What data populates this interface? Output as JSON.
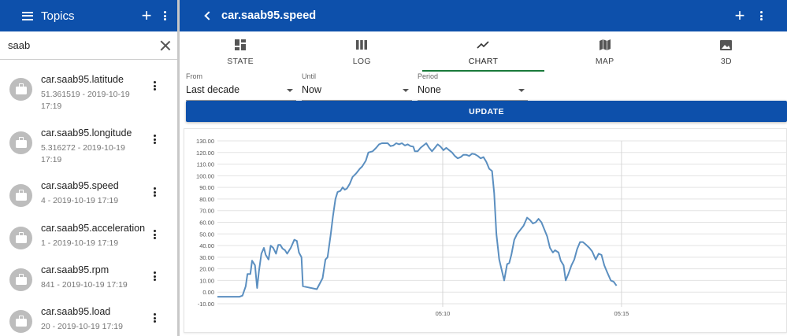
{
  "sidebar": {
    "title": "Topics",
    "search": {
      "value": "saab"
    },
    "topics": [
      {
        "name": "car.saab95.latitude",
        "detail": "51.361519 - 2019-10-19 17:19"
      },
      {
        "name": "car.saab95.longitude",
        "detail": "5.316272 - 2019-10-19 17:19"
      },
      {
        "name": "car.saab95.speed",
        "detail": "4 - 2019-10-19 17:19"
      },
      {
        "name": "car.saab95.acceleration",
        "detail": "1 - 2019-10-19 17:19"
      },
      {
        "name": "car.saab95.rpm",
        "detail": "841 - 2019-10-19 17:19"
      },
      {
        "name": "car.saab95.load",
        "detail": "20 - 2019-10-19 17:19"
      }
    ]
  },
  "main": {
    "title": "car.saab95.speed",
    "tabs": [
      {
        "label": "STATE",
        "icon": "dashboard-icon"
      },
      {
        "label": "LOG",
        "icon": "columns-icon"
      },
      {
        "label": "CHART",
        "icon": "line-chart-icon",
        "active": true
      },
      {
        "label": "MAP",
        "icon": "map-icon"
      },
      {
        "label": "3D",
        "icon": "image-icon"
      }
    ],
    "from": {
      "caption": "From",
      "value": "Last decade"
    },
    "until": {
      "caption": "Until",
      "value": "Now"
    },
    "period": {
      "caption": "Period",
      "value": "None"
    },
    "update_label": "UPDATE"
  },
  "colors": {
    "appbar": "#0d50ab",
    "line": "#5b8fc0",
    "active_tab": "#1a7a3a",
    "avatar": "#bdbdbd"
  },
  "chart_data": {
    "type": "line",
    "title": "",
    "xlabel": "",
    "ylabel": "",
    "ylim": [
      -10,
      130
    ],
    "y_ticks": [
      "-10.00",
      "0.00",
      "10.00",
      "20.00",
      "30.00",
      "40.00",
      "50.00",
      "60.00",
      "70.00",
      "80.00",
      "90.00",
      "100.00",
      "110.00",
      "120.00",
      "130.00"
    ],
    "x_ticks": [
      {
        "label": "05:10",
        "x": 10.0
      },
      {
        "label": "05:15",
        "x": 15.0
      }
    ],
    "xlim": [
      3.7,
      19.65
    ],
    "grid": true,
    "series": [
      {
        "values": [
          [
            3.7,
            -4
          ],
          [
            4.32,
            -4
          ],
          [
            4.4,
            -3
          ],
          [
            4.49,
            5
          ],
          [
            4.54,
            15.5
          ],
          [
            4.62,
            15.5
          ],
          [
            4.67,
            27
          ],
          [
            4.75,
            23
          ],
          [
            4.81,
            3.5
          ],
          [
            4.86,
            18
          ],
          [
            4.93,
            33
          ],
          [
            5.0,
            38
          ],
          [
            5.05,
            32
          ],
          [
            5.13,
            28
          ],
          [
            5.19,
            40
          ],
          [
            5.26,
            38
          ],
          [
            5.34,
            33
          ],
          [
            5.4,
            40.5
          ],
          [
            5.46,
            40.5
          ],
          [
            5.52,
            37.5
          ],
          [
            5.59,
            36
          ],
          [
            5.65,
            33
          ],
          [
            5.75,
            38
          ],
          [
            5.85,
            45
          ],
          [
            5.92,
            44
          ],
          [
            5.98,
            34
          ],
          [
            6.05,
            30
          ],
          [
            6.09,
            5
          ],
          [
            6.48,
            2.5
          ],
          [
            6.64,
            12
          ],
          [
            6.72,
            28
          ],
          [
            6.78,
            30
          ],
          [
            6.87,
            50
          ],
          [
            6.93,
            65
          ],
          [
            7.0,
            80
          ],
          [
            7.06,
            86
          ],
          [
            7.14,
            87
          ],
          [
            7.2,
            90
          ],
          [
            7.26,
            88
          ],
          [
            7.32,
            89
          ],
          [
            7.4,
            93
          ],
          [
            7.48,
            99
          ],
          [
            7.58,
            102
          ],
          [
            7.68,
            106
          ],
          [
            7.75,
            108
          ],
          [
            7.85,
            113
          ],
          [
            7.92,
            120
          ],
          [
            8.04,
            121
          ],
          [
            8.14,
            124
          ],
          [
            8.22,
            127
          ],
          [
            8.3,
            128
          ],
          [
            8.38,
            128
          ],
          [
            8.46,
            128
          ],
          [
            8.54,
            125.5
          ],
          [
            8.62,
            126
          ],
          [
            8.7,
            128
          ],
          [
            8.78,
            127
          ],
          [
            8.86,
            128
          ],
          [
            8.94,
            126
          ],
          [
            9.02,
            127
          ],
          [
            9.1,
            125.5
          ],
          [
            9.18,
            125
          ],
          [
            9.22,
            121
          ],
          [
            9.3,
            121
          ],
          [
            9.38,
            124
          ],
          [
            9.46,
            126
          ],
          [
            9.54,
            128
          ],
          [
            9.62,
            124
          ],
          [
            9.7,
            121
          ],
          [
            9.78,
            124
          ],
          [
            9.86,
            127
          ],
          [
            9.94,
            125
          ],
          [
            10.02,
            122
          ],
          [
            10.1,
            124
          ],
          [
            10.18,
            122
          ],
          [
            10.26,
            120
          ],
          [
            10.34,
            117
          ],
          [
            10.42,
            115
          ],
          [
            10.5,
            116
          ],
          [
            10.58,
            118
          ],
          [
            10.66,
            118
          ],
          [
            10.74,
            117
          ],
          [
            10.82,
            119
          ],
          [
            10.9,
            118.5
          ],
          [
            10.98,
            117
          ],
          [
            11.06,
            115
          ],
          [
            11.14,
            116
          ],
          [
            11.22,
            112
          ],
          [
            11.3,
            106
          ],
          [
            11.38,
            104
          ],
          [
            11.44,
            85
          ],
          [
            11.5,
            50
          ],
          [
            11.58,
            28
          ],
          [
            11.72,
            10
          ],
          [
            11.8,
            24
          ],
          [
            11.86,
            25
          ],
          [
            11.92,
            32
          ],
          [
            12.0,
            45
          ],
          [
            12.08,
            50
          ],
          [
            12.16,
            53
          ],
          [
            12.26,
            57
          ],
          [
            12.36,
            64
          ],
          [
            12.44,
            62
          ],
          [
            12.52,
            59
          ],
          [
            12.6,
            60
          ],
          [
            12.68,
            63
          ],
          [
            12.76,
            60
          ],
          [
            12.84,
            54
          ],
          [
            12.92,
            48
          ],
          [
            13.0,
            38
          ],
          [
            13.08,
            34
          ],
          [
            13.14,
            36
          ],
          [
            13.24,
            34
          ],
          [
            13.3,
            27
          ],
          [
            13.38,
            23
          ],
          [
            13.44,
            10
          ],
          [
            13.52,
            16
          ],
          [
            13.6,
            23
          ],
          [
            13.68,
            28
          ],
          [
            13.76,
            37
          ],
          [
            13.84,
            43
          ],
          [
            13.92,
            43
          ],
          [
            14.0,
            41
          ],
          [
            14.1,
            38
          ],
          [
            14.18,
            35
          ],
          [
            14.28,
            28
          ],
          [
            14.36,
            33
          ],
          [
            14.44,
            32
          ],
          [
            14.52,
            23
          ],
          [
            14.6,
            17
          ],
          [
            14.7,
            10
          ],
          [
            14.78,
            9
          ],
          [
            14.86,
            5.5
          ]
        ]
      }
    ]
  }
}
